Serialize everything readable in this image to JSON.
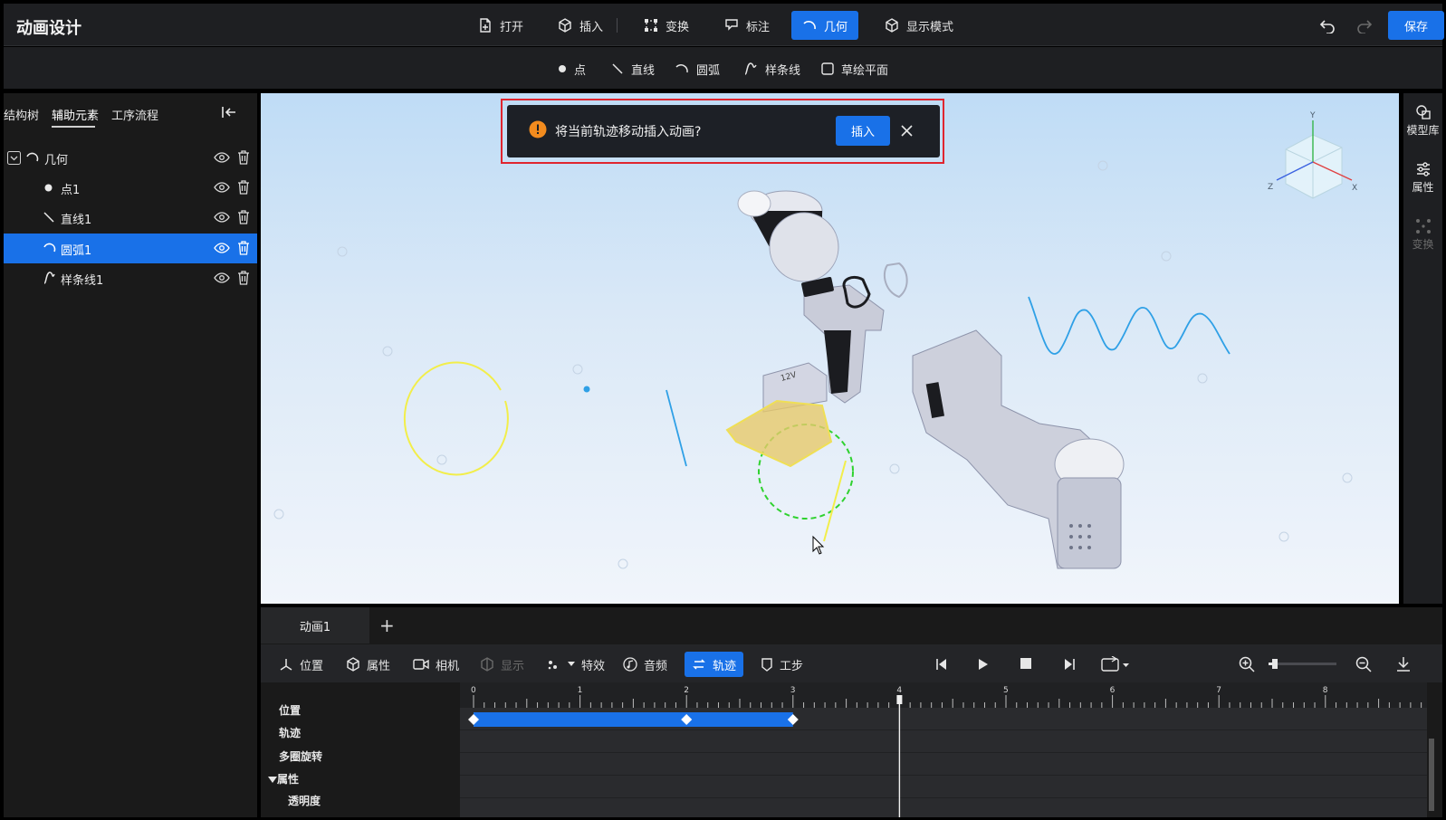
{
  "app": {
    "title": "动画设计"
  },
  "toolbar": {
    "open": "打开",
    "insert": "插入",
    "transform": "变换",
    "annotate": "标注",
    "geometry": "几何",
    "display_mode": "显示模式",
    "save": "保存"
  },
  "geometry_bar": {
    "point": "点",
    "line": "直线",
    "arc": "圆弧",
    "spline": "样条线",
    "sketch_plane": "草绘平面"
  },
  "left_panel": {
    "tabs": [
      "结构树",
      "辅助元素",
      "工序流程"
    ],
    "active_tab": "辅助元素",
    "tree": [
      {
        "label": "几何",
        "icon": "arc-icon",
        "level": 0,
        "selected": false
      },
      {
        "label": "点1",
        "icon": "point-icon",
        "level": 1,
        "selected": false
      },
      {
        "label": "直线1",
        "icon": "line-icon",
        "level": 1,
        "selected": false
      },
      {
        "label": "圆弧1",
        "icon": "arc-icon",
        "level": 1,
        "selected": true
      },
      {
        "label": "样条线1",
        "icon": "spline-icon",
        "level": 1,
        "selected": false
      }
    ]
  },
  "notification": {
    "message": "将当前轨迹移动插入动画?",
    "action": "插入"
  },
  "view_cube": {
    "axis_x": "X",
    "axis_y": "Y",
    "axis_z": "Z"
  },
  "right_panel": {
    "model_library": "模型库",
    "properties": "属性",
    "transform": "变换"
  },
  "animation": {
    "tab": "动画1",
    "add_tab": "+",
    "toolbar": {
      "position": "位置",
      "properties": "属性",
      "camera": "相机",
      "display": "显示",
      "effects": "特效",
      "audio": "音频",
      "trajectory": "轨迹",
      "step": "工步"
    },
    "tracks": [
      "位置",
      "轨迹",
      "多圈旋转",
      "属性",
      "透明度"
    ],
    "ruler_labels": [
      "0",
      "1",
      "2",
      "3",
      "4",
      "5",
      "6",
      "7",
      "8"
    ],
    "playhead_time": 4,
    "keyframes": [
      0,
      2,
      3
    ],
    "zoom_level": 0.05
  },
  "colors": {
    "accent": "#1971e8",
    "alert_border": "#e0252f",
    "warning": "#f28b1e"
  }
}
